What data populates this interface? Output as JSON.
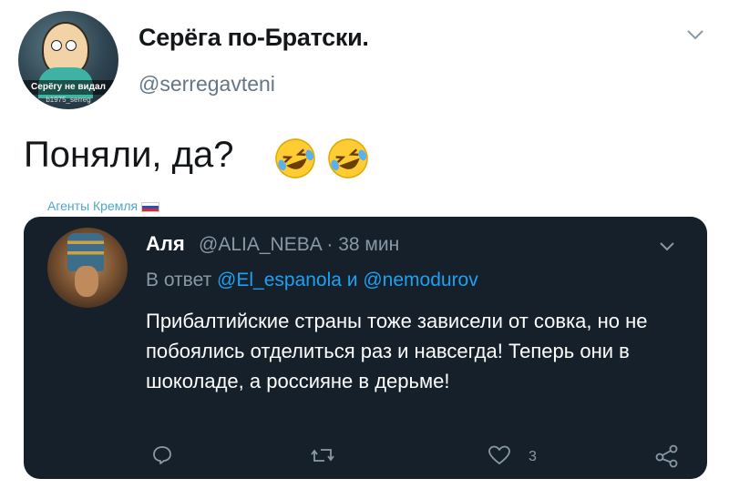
{
  "profile": {
    "display_name": "Серёга по-Братски.",
    "handle": "@serregavteni",
    "avatar_caption": "Серёгу не видал",
    "avatar_subcaption": "b1975_serreg"
  },
  "tweet": {
    "text": "Поняли, да?",
    "emojis": [
      "rolling-on-floor-laughing",
      "rolling-on-floor-laughing"
    ]
  },
  "label": {
    "text": "Агенты Кремля"
  },
  "quoted": {
    "name": "Аля",
    "handle_time": "@ALIA_NEBA · 38 мин",
    "reply_prefix": "В ответ",
    "reply_mentions": "@El_espanola и @nemodurov",
    "body": "Прибалтийские страны тоже зависели от совка, но не побоялись отделиться раз и навсегда! Теперь они в шоколаде, а россияне в дерьме!",
    "likes": "3"
  },
  "colors": {
    "card_bg": "#15202b",
    "mention": "#1da1f2",
    "muted": "#8899a6"
  }
}
